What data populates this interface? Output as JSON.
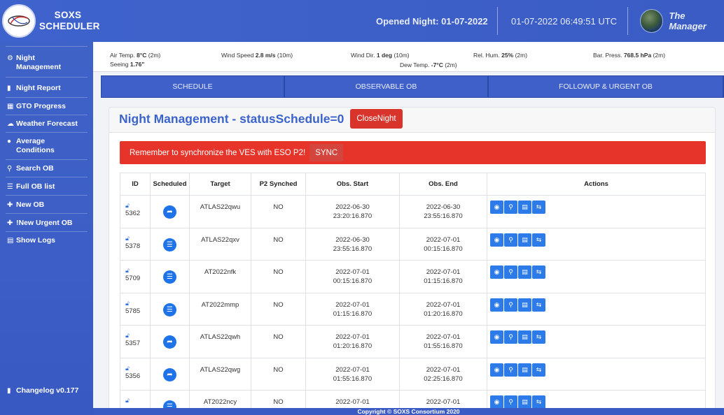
{
  "header": {
    "brand_line1": "SOXS",
    "brand_line2": "SCHEDULER",
    "opened_night": "Opened Night: 01-07-2022",
    "datetime": "01-07-2022 06:49:51 UTC",
    "user": "The Manager"
  },
  "sidebar": {
    "items": [
      {
        "icon": "gear-icon",
        "glyph": "⚙",
        "label": "Night Management"
      },
      {
        "icon": "file-icon",
        "glyph": "▮",
        "label": "Night Report"
      },
      {
        "icon": "calendar-icon",
        "glyph": "▦",
        "label": "GTO Progress"
      },
      {
        "icon": "cloud-icon",
        "glyph": "☁",
        "label": "Weather Forecast"
      },
      {
        "icon": "info-icon",
        "glyph": "●",
        "label": "Average Conditions"
      },
      {
        "icon": "search-icon",
        "glyph": "⚲",
        "label": "Search OB"
      },
      {
        "icon": "list-icon",
        "glyph": "☰",
        "label": "Full OB list"
      },
      {
        "icon": "plus-circle-icon",
        "glyph": "✚",
        "label": "New OB"
      },
      {
        "icon": "plus-circle-icon",
        "glyph": "✚",
        "label": "!New Urgent OB"
      },
      {
        "icon": "log-icon",
        "glyph": "▤",
        "label": "Show Logs"
      }
    ],
    "changelog": "Changelog v0.177"
  },
  "weather": {
    "air_temp_label": "Air Temp.",
    "air_temp": "8°C",
    "air_temp_h": "(2m)",
    "seeing_label": "Seeing",
    "seeing": "1.76\"",
    "wind_speed_label": "Wind Speed",
    "wind_speed": "2.8 m/s",
    "wind_speed_h": "(10m)",
    "wind_dir_label": "Wind Dir.",
    "wind_dir": "1 deg",
    "wind_dir_h": "(10m)",
    "dew_temp_label": "Dew Temp.",
    "dew_temp": "-7°C",
    "dew_temp_h": "(2m)",
    "hum_label": "Rel. Hum.",
    "hum": "25%",
    "hum_h": "(2m)",
    "press_label": "Bar. Press.",
    "press": "768.5 hPa",
    "press_h": "(2m)"
  },
  "tabs": [
    "SCHEDULE",
    "OBSERVABLE OB",
    "FOLLOWUP & URGENT OB"
  ],
  "main": {
    "title": "Night Management - statusSchedule=0",
    "close_button": "CloseNight",
    "alert_text": "Remember to synchronize the VES with ESO P2!",
    "sync_button": "SYNC"
  },
  "table": {
    "headers": [
      "ID",
      "Scheduled",
      "Target",
      "P2 Synched",
      "Obs. Start",
      "Obs. End",
      "Actions"
    ],
    "rows": [
      {
        "id": "5362",
        "sched": "runner",
        "target": "ATLAS22qwu",
        "p2": "NO",
        "start_date": "2022-06-30",
        "start_time": "23:20:16.870",
        "end_date": "2022-06-30",
        "end_time": "23:55:16.870"
      },
      {
        "id": "5378",
        "sched": "layers",
        "target": "ATLAS22qxv",
        "p2": "NO",
        "start_date": "2022-06-30",
        "start_time": "23:55:16.870",
        "end_date": "2022-07-01",
        "end_time": "00:15:16.870"
      },
      {
        "id": "5709",
        "sched": "layers",
        "target": "AT2022nfk",
        "p2": "NO",
        "start_date": "2022-07-01",
        "start_time": "00:15:16.870",
        "end_date": "2022-07-01",
        "end_time": "01:15:16.870"
      },
      {
        "id": "5785",
        "sched": "layers",
        "target": "AT2022mmp",
        "p2": "NO",
        "start_date": "2022-07-01",
        "start_time": "01:15:16.870",
        "end_date": "2022-07-01",
        "end_time": "01:20:16.870"
      },
      {
        "id": "5357",
        "sched": "runner",
        "target": "ATLAS22qwh",
        "p2": "NO",
        "start_date": "2022-07-01",
        "start_time": "01:20:16.870",
        "end_date": "2022-07-01",
        "end_time": "01:55:16.870"
      },
      {
        "id": "5356",
        "sched": "runner",
        "target": "ATLAS22qwg",
        "p2": "NO",
        "start_date": "2022-07-01",
        "start_time": "01:55:16.870",
        "end_date": "2022-07-01",
        "end_time": "02:25:16.870"
      },
      {
        "id": "",
        "sched": "layers",
        "target": "AT2022ncy",
        "p2": "NO",
        "start_date": "2022-07-01",
        "start_time": "",
        "end_date": "2022-07-01",
        "end_time": ""
      }
    ]
  },
  "footer": "Copyright © SOXS Consortium 2020"
}
